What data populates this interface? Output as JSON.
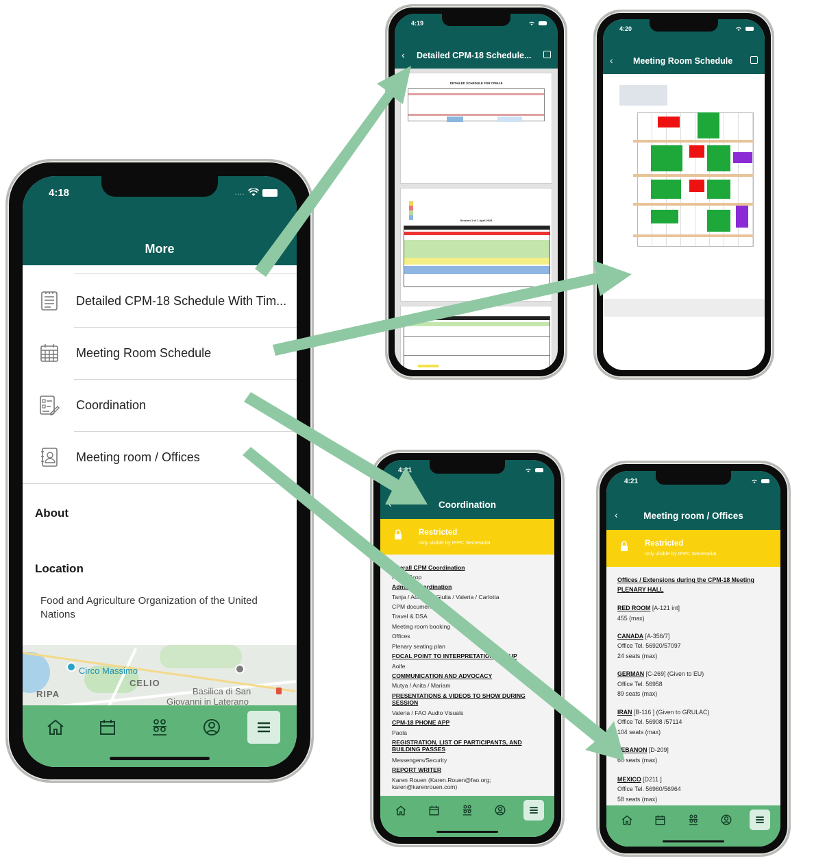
{
  "main": {
    "status_time": "4:18",
    "header_title": "More",
    "menu_items": [
      {
        "label": "Detailed CPM-18 Schedule With Tim...",
        "icon": "document-icon"
      },
      {
        "label": "Meeting Room Schedule",
        "icon": "calendar-grid-icon"
      },
      {
        "label": "Coordination",
        "icon": "checklist-edit-icon"
      },
      {
        "label": "Meeting room / Offices",
        "icon": "contact-card-icon"
      }
    ],
    "about_heading": "About",
    "location_heading": "Location",
    "location_text": "Food and Agriculture Organization of the United Nations",
    "map_labels": [
      "Circo Massimo",
      "CELIO",
      "RIPA",
      "Basilica di San",
      "Giovanni in Laterano"
    ]
  },
  "tabbar_icons": [
    "home-icon",
    "calendar-icon",
    "people-icon",
    "profile-icon",
    "menu-icon"
  ],
  "schedule_screen": {
    "status_time": "4:19",
    "title": "Detailed CPM-18 Schedule...",
    "doc_title": "DETAILED SCHEDULE FOR CPM-18",
    "section_caption": "Session 1 of 1 April 2024"
  },
  "room_schedule_screen": {
    "status_time": "4:20",
    "title": "Meeting Room Schedule"
  },
  "coordination_screen": {
    "status_time": "4:21",
    "title": "Coordination",
    "banner_title": "Restricted",
    "banner_sub": "only visible by IPPC Secretariat",
    "lines": [
      {
        "text": "Overall CPM Coordination",
        "heading": true
      },
      {
        "text": "Avetik Arop",
        "heading": false
      },
      {
        "text": "Admin / Coordination",
        "heading": true
      },
      {
        "text": "Tanja / Adriana / Giulia / Valeria / Carlotta",
        "heading": false
      },
      {
        "text": "CPM documents",
        "heading": false
      },
      {
        "text": "Travel & DSA",
        "heading": false
      },
      {
        "text": "Meeting room booking",
        "heading": false
      },
      {
        "text": "Offices",
        "heading": false
      },
      {
        "text": "Plenary seating plan",
        "heading": false
      },
      {
        "text": "FOCAL POINT TO INTERPRETATION GROUP",
        "heading": true
      },
      {
        "text": "Aoife",
        "heading": false
      },
      {
        "text": "COMMUNICATION AND ADVOCACY",
        "heading": true
      },
      {
        "text": "Mutya / Anita / Mariam",
        "heading": false
      },
      {
        "text": "PRESENTATIONS & VIDEOS TO SHOW DURING SESSION",
        "heading": true
      },
      {
        "text": "Valeria / FAO Audio Visuals",
        "heading": false
      },
      {
        "text": "CPM-18 PHONE APP",
        "heading": true
      },
      {
        "text": "Paola",
        "heading": false
      },
      {
        "text": "REGISTRATION, LIST OF PARTICIPANTS, AND BUILDING PASSES",
        "heading": true
      },
      {
        "text": "Messengers/Security",
        "heading": false
      },
      {
        "text": "REPORT WRITER",
        "heading": true
      },
      {
        "text": "Karen Rouen (Karen.Rouen@fao.org; karen@karenrouen.com)",
        "heading": false
      }
    ]
  },
  "offices_screen": {
    "status_time": "4:21",
    "title": "Meeting room / Offices",
    "banner_title": "Restricted",
    "banner_sub": "only visible by IPPC Secretariat",
    "intro": "Offices / Extensions during the CPM-18 Meeting",
    "plenary": "PLENARY HALL",
    "rooms": [
      {
        "name": "RED ROOM",
        "code": "[A-121 int]",
        "lines": [
          "455 (max)"
        ]
      },
      {
        "name": "CANADA",
        "code": "[A-356/7]",
        "lines": [
          "Office Tel. 56920/57097",
          "24 seats (max)"
        ]
      },
      {
        "name": "GERMAN",
        "code": "[C-269]   (Given to EU)",
        "lines": [
          "Office Tel. 56958",
          "89 seats (max)"
        ]
      },
      {
        "name": "IRAN",
        "code": "[B-116 ] (Given to GRULAC)",
        "lines": [
          "Office Tel. 56908 /57114",
          "104 seats (max)"
        ]
      },
      {
        "name": "LEBANON",
        "code": "[D-209]",
        "lines": [
          "60 seats (max)"
        ]
      },
      {
        "name": "MEXICO",
        "code": "[D211 ]",
        "lines": [
          "Office Tel. 56960/56964",
          "58 seats (max)"
        ]
      }
    ]
  },
  "colors": {
    "header_green": "#0d5c57",
    "tabbar_green": "#5fb579",
    "arrow_green": "#8fc9a3",
    "banner_yellow": "#f9d20d"
  }
}
